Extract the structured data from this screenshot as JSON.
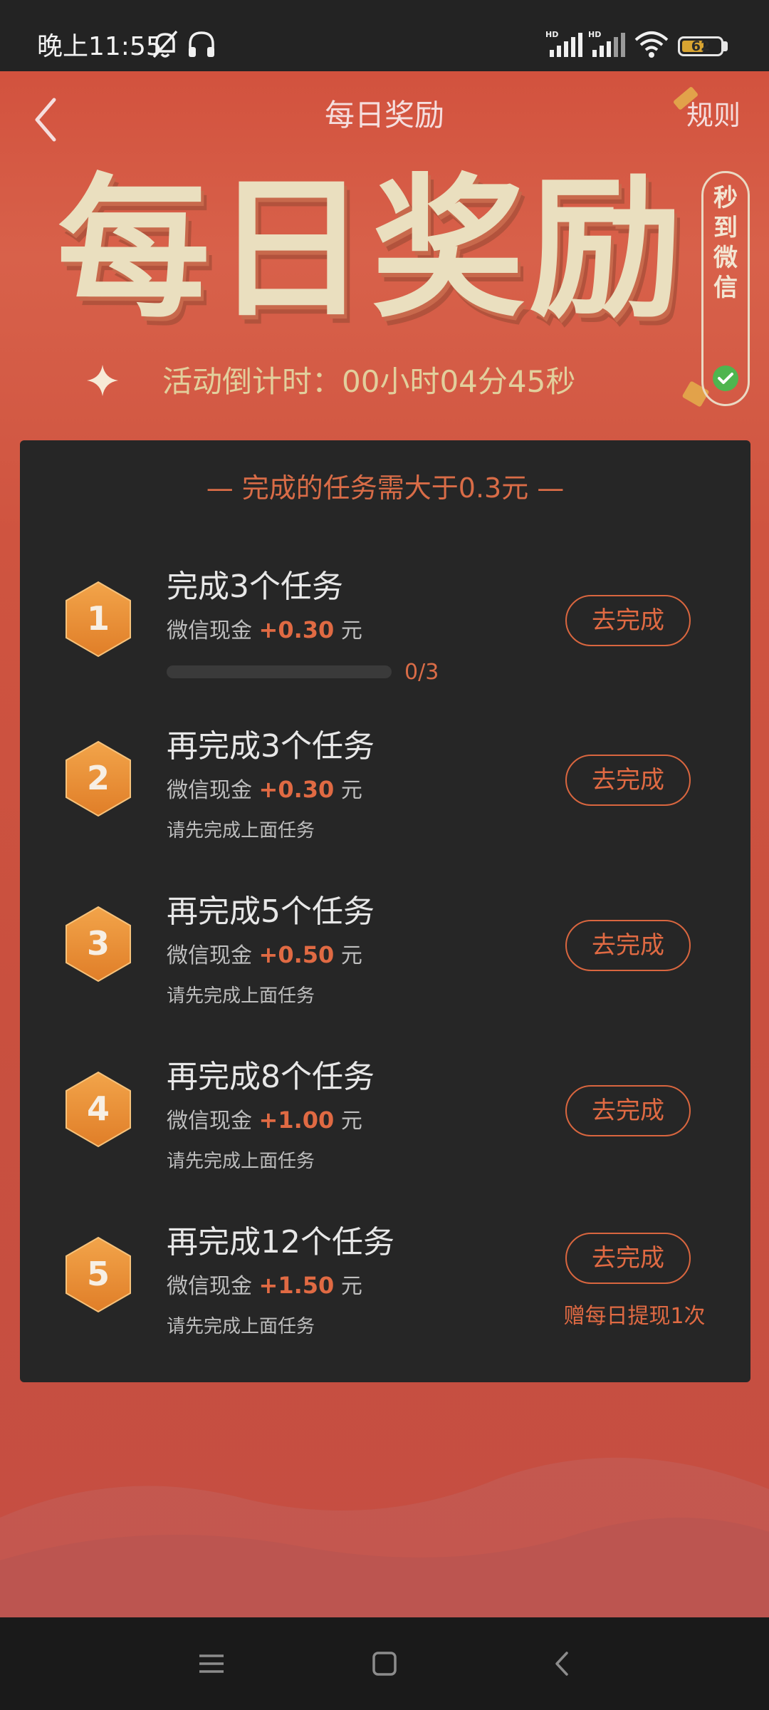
{
  "status_bar": {
    "time": "晚上11:55",
    "battery": "62",
    "battery_level": 0.62,
    "icons": [
      "bell-off-icon",
      "headphones-icon",
      "signal-hd-icon",
      "signal-hd-icon",
      "wifi-icon",
      "battery-icon"
    ]
  },
  "header": {
    "title": "每日奖励",
    "rules": "规则",
    "back_icon": "chevron-left-icon"
  },
  "banner": {
    "title": "每日奖励",
    "badge": "秒到微信",
    "countdown_label": "活动倒计时：",
    "countdown_value": "00小时04分45秒"
  },
  "panel": {
    "header": "— 完成的任务需大于0.3元 —",
    "reward_prefix": "微信现金",
    "reward_unit": "元",
    "button_label": "去完成",
    "tasks": [
      {
        "number": "1",
        "title": "完成3个任务",
        "amount": "+0.30",
        "progress_text": "0/3",
        "progress_fraction": 0
      },
      {
        "number": "2",
        "title": "再完成3个任务",
        "amount": "+0.30",
        "note": "请先完成上面任务"
      },
      {
        "number": "3",
        "title": "再完成5个任务",
        "amount": "+0.50",
        "note": "请先完成上面任务"
      },
      {
        "number": "4",
        "title": "再完成8个任务",
        "amount": "+1.00",
        "note": "请先完成上面任务"
      },
      {
        "number": "5",
        "title": "再完成12个任务",
        "amount": "+1.50",
        "note": "请先完成上面任务",
        "bonus": "赠每日提现1次"
      }
    ]
  },
  "nav_bar": {
    "icons": [
      "menu-icon",
      "home-icon",
      "back-icon"
    ]
  },
  "colors": {
    "accent": "#e06a43",
    "background_red": "#cf5440",
    "panel": "#262626",
    "gold": "#eadfbf"
  }
}
